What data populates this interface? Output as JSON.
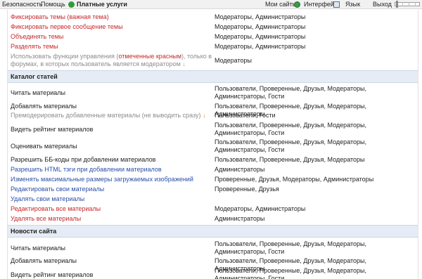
{
  "topbar": {
    "security": "Безопасность",
    "help": "Помощь",
    "paid": "Платные услуги",
    "my_sites": "Мои сайты",
    "interface": "Интерфейс",
    "language": "Язык",
    "logout": "Выход"
  },
  "rows_top": [
    {
      "perm": "Фиксировать темы (важная тема)",
      "who": "Модераторы, Администраторы"
    },
    {
      "perm": "Фиксировать первое сообщение темы",
      "who": "Модераторы, Администраторы"
    },
    {
      "perm": "Объединять темы",
      "who": "Модераторы, Администраторы"
    },
    {
      "perm": "Разделять темы",
      "who": "Модераторы, Администраторы"
    }
  ],
  "special": {
    "text_a": "Использовать функции управления (",
    "marked": "отмеченные красным",
    "text_b": "), только в форумах, в которых пользователь является модератором",
    "arrow": "↓",
    "who": "Модераторы"
  },
  "section_catalog": "Каталог статей",
  "catalog": [
    {
      "perm": "Читать материалы",
      "who": "Пользователи, Проверенные, Друзья, Модераторы, Администраторы, Гости"
    },
    {
      "perm": "Добавлять материалы",
      "who": "Пользователи, Проверенные, Друзья, Модераторы, Администраторы"
    },
    {
      "perm": "Премодерировать добавленные материалы (не выводить сразу)",
      "arrow": "↓",
      "who": "Пользователи, Гости"
    },
    {
      "perm": "Видеть рейтинг материалов",
      "who": "Пользователи, Проверенные, Друзья, Модераторы, Администраторы, Гости"
    },
    {
      "perm": "Оценивать материалы",
      "who": "Пользователи, Проверенные, Друзья, Модераторы, Администраторы, Гости"
    },
    {
      "perm": "Разрешить ББ-коды при добавлении материалов",
      "who": "Пользователи, Проверенные, Друзья, Модераторы"
    },
    {
      "perm": "Разрешить HTML тэги при добавлении материалов",
      "who": "Администраторы"
    },
    {
      "perm": "Изменять максимальные размеры загружаемых изображений",
      "who": "Проверенные, Друзья, Модераторы, Администраторы"
    },
    {
      "perm": "Редактировать свои материалы",
      "who": "Проверенные, Друзья"
    },
    {
      "perm": "Удалять свои материалы",
      "who": ""
    },
    {
      "perm": "Редактировать все материалы",
      "who": "Модераторы, Администраторы"
    },
    {
      "perm": "Удалять все материалы",
      "who": "Администраторы"
    }
  ],
  "section_news": "Новости сайта",
  "news": [
    {
      "perm": "Читать материалы",
      "who": "Пользователи, Проверенные, Друзья, Модераторы, Администраторы, Гости"
    },
    {
      "perm": "Добавлять материалы",
      "who": "Пользователи, Проверенные, Друзья, Модераторы, Администраторы"
    },
    {
      "perm": "Видеть рейтинг материалов",
      "who": "Пользователи, Проверенные, Друзья, Модераторы, Администраторы, Гости"
    }
  ],
  "colors": {
    "red": "#c8282a",
    "blue": "#2b4fa8",
    "gray": "#8c8c8c",
    "section_bg": "#e6ecf5"
  }
}
